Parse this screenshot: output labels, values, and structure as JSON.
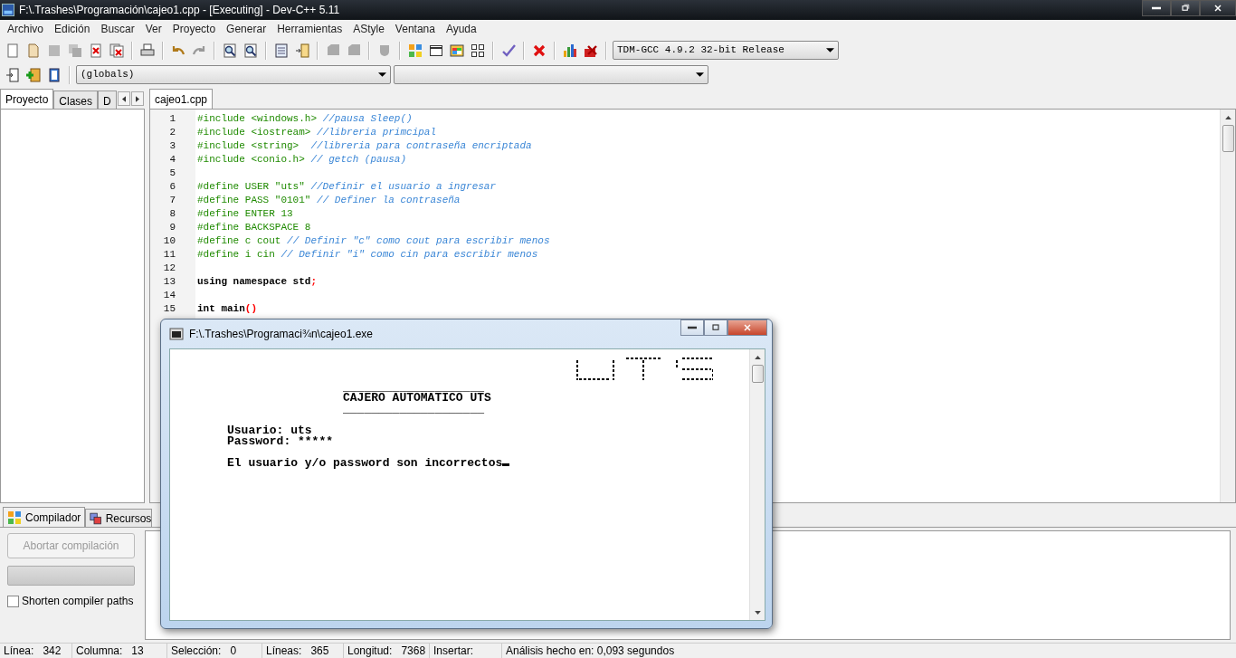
{
  "window": {
    "title": "F:\\.Trashes\\Programación\\cajeo1.cpp - [Executing] - Dev-C++ 5.11"
  },
  "menu": [
    "Archivo",
    "Edición",
    "Buscar",
    "Ver",
    "Proyecto",
    "Generar",
    "Herramientas",
    "AStyle",
    "Ventana",
    "Ayuda"
  ],
  "toolbar": {
    "compiler": "TDM-GCC 4.9.2 32-bit Release",
    "scope": "(globals)"
  },
  "left_tabs": [
    {
      "label": "Proyecto",
      "selected": true
    },
    {
      "label": "Clases",
      "selected": false
    },
    {
      "label": "D",
      "selected": false
    }
  ],
  "editor_tabs": [
    {
      "label": "cajeo1.cpp",
      "selected": true
    }
  ],
  "code": [
    {
      "number": "1",
      "parts": [
        {
          "kind": "directive",
          "text": "#include <windows.h> "
        },
        {
          "kind": "comment",
          "text": "//pausa Sleep()"
        }
      ]
    },
    {
      "number": "2",
      "parts": [
        {
          "kind": "directive",
          "text": "#include <iostream> "
        },
        {
          "kind": "comment",
          "text": "//libreria primcipal"
        }
      ]
    },
    {
      "number": "3",
      "parts": [
        {
          "kind": "directive",
          "text": "#include <string>  "
        },
        {
          "kind": "comment",
          "text": "//libreria para contraseña encriptada"
        }
      ]
    },
    {
      "number": "4",
      "parts": [
        {
          "kind": "directive",
          "text": "#include <conio.h> "
        },
        {
          "kind": "comment",
          "text": "// getch (pausa)"
        }
      ]
    },
    {
      "number": "5"
    },
    {
      "number": "6",
      "parts": [
        {
          "kind": "directive",
          "text": "#define USER \"uts\" "
        },
        {
          "kind": "comment",
          "text": "//Definir el usuario a ingresar"
        }
      ]
    },
    {
      "number": "7",
      "parts": [
        {
          "kind": "directive",
          "text": "#define PASS \"0101\" "
        },
        {
          "kind": "comment",
          "text": "// Definer la contraseña"
        }
      ]
    },
    {
      "number": "8",
      "parts": [
        {
          "kind": "directive",
          "text": "#define ENTER 13"
        }
      ]
    },
    {
      "number": "9",
      "parts": [
        {
          "kind": "directive",
          "text": "#define BACKSPACE 8"
        }
      ]
    },
    {
      "number": "10",
      "parts": [
        {
          "kind": "directive",
          "text": "#define c cout "
        },
        {
          "kind": "comment",
          "text": "// Definir \"c\" como cout para escribir menos"
        }
      ]
    },
    {
      "number": "11",
      "parts": [
        {
          "kind": "directive",
          "text": "#define i cin "
        },
        {
          "kind": "comment",
          "text": "// Definir \"i\" como cin para escribir menos"
        }
      ]
    },
    {
      "number": "12"
    },
    {
      "number": "13",
      "parts": [
        {
          "kind": "keyword",
          "text": "using namespace std"
        },
        {
          "kind": "symbol",
          "text": ";"
        }
      ]
    },
    {
      "number": "14"
    },
    {
      "number": "15",
      "parts": [
        {
          "kind": "keyword",
          "text": "int main"
        },
        {
          "kind": "symbol",
          "text": "()"
        }
      ]
    }
  ],
  "bottom_tabs": [
    {
      "label": "Compilador",
      "selected": true
    },
    {
      "label": "Recursos",
      "selected": false
    }
  ],
  "compiler_panel": {
    "abort_button": {
      "label": "Abortar compilación",
      "disabled": true
    },
    "progress": {
      "level": 0
    },
    "shorten_paths": {
      "label": "Shorten compiler paths",
      "checked": false
    }
  },
  "status_bar": [
    {
      "label": "Línea:",
      "value": "342"
    },
    {
      "label": "Columna:",
      "value": "13"
    },
    {
      "label": "Selección:",
      "value": "0"
    },
    {
      "label": "Líneas:",
      "value": "365"
    },
    {
      "label": "Longitud:",
      "value": "7368"
    },
    {
      "label": "Insertar:"
    },
    {
      "label": "Análisis hecho en: 0,093 segundos"
    }
  ],
  "console": {
    "title": "F:\\.Trashes\\Programaci¾n\\cajeo1.exe",
    "lines": [
      {
        "kind": "rule",
        "text": "____________________"
      },
      {
        "kind": "heading",
        "text": "CAJERO AUTOMATICO UTS"
      },
      {
        "kind": "rule",
        "text": "____________________"
      },
      {
        "kind": "field",
        "text": "Usuario: uts"
      },
      {
        "kind": "field",
        "text": "Password: *****"
      },
      {
        "kind": "message",
        "text": "El usuario y/o password son incorrectos"
      }
    ]
  }
}
